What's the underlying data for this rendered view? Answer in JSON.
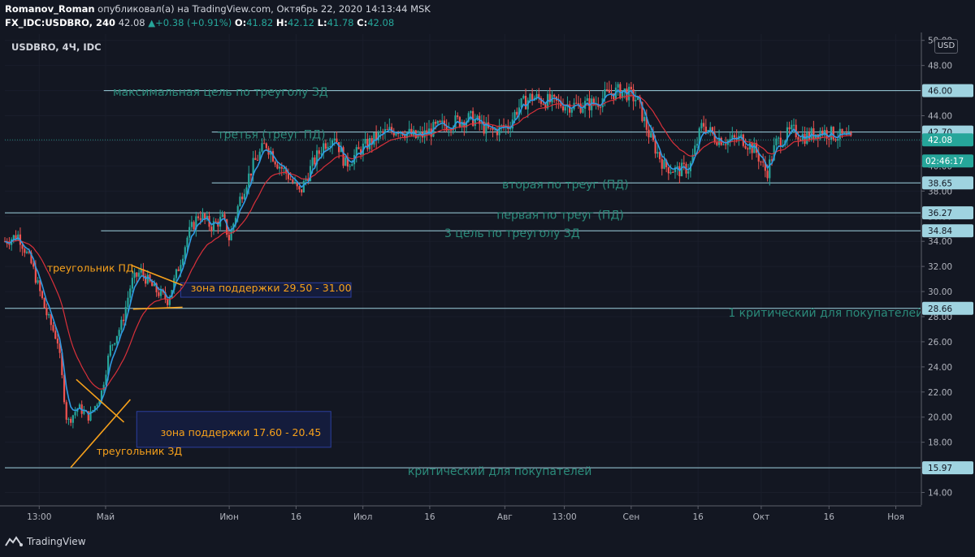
{
  "header": {
    "author": "Romanov_Roman",
    "published_text": " опубликовал(а) на TradingView.com, Октябрь 22, 2020 14:13:44 MSK",
    "ticker": "FX_IDC:USDBRO, 240",
    "last": "42.08",
    "change": "+0.38 (+0.91%)",
    "o_label": "O:",
    "o": "41.82",
    "h_label": "H:",
    "h": "42.12",
    "l_label": "L:",
    "l": "41.78",
    "c_label": "C:",
    "c": "42.08"
  },
  "symbol_label": "USDBRO, 4Ч, IDC",
  "currency_button": "USD",
  "brand": "TradingView",
  "colors": {
    "background": "#131722",
    "level_line": "#9fd3e0",
    "ema_fast": "#2f9ae3",
    "ema_slow": "#d9303a",
    "candle_up": "#26a69a",
    "candle_down": "#ef5350",
    "annotation_teal": "#2b8a7a",
    "annotation_orange": "#f7a11b",
    "zone_border": "#2c3f9f",
    "zone_fill": "#141c3c",
    "price_tag_bg": "#9fd3e0",
    "current_price_bg": "#26a69a"
  },
  "chart_data": {
    "type": "candlestick",
    "instrument": "USDBRO",
    "timeframe": "4Ч",
    "ylim": [
      13,
      50.5
    ],
    "y_ticks": [
      14,
      16,
      18,
      20,
      22,
      24,
      26,
      28,
      30,
      32,
      34,
      36,
      38,
      40,
      42,
      44,
      46,
      48,
      50
    ],
    "y_tick_labels": [
      "14.00",
      "16.00",
      "18.00",
      "20.00",
      "22.00",
      "24.00",
      "26.00",
      "28.00",
      "30.00",
      "32.00",
      "34.00",
      "36.00",
      "38.00",
      "40.00",
      "42.00",
      "44.00",
      "46.00",
      "48.00",
      "50.00"
    ],
    "x_ticks": [
      {
        "label": "13:00",
        "pos": 0.0375
      },
      {
        "label": "Май",
        "pos": 0.11
      },
      {
        "label": "Июн",
        "pos": 0.245
      },
      {
        "label": "16",
        "pos": 0.318
      },
      {
        "label": "Июл",
        "pos": 0.391
      },
      {
        "label": "16",
        "pos": 0.464
      },
      {
        "label": "Авг",
        "pos": 0.546
      },
      {
        "label": "13:00",
        "pos": 0.611
      },
      {
        "label": "Сен",
        "pos": 0.684
      },
      {
        "label": "16",
        "pos": 0.757
      },
      {
        "label": "Окт",
        "pos": 0.826
      },
      {
        "label": "16",
        "pos": 0.9
      },
      {
        "label": "Ноя",
        "pos": 0.973
      }
    ],
    "price_path": [
      [
        0.0,
        34.0
      ],
      [
        0.015,
        34.5
      ],
      [
        0.03,
        32.0
      ],
      [
        0.045,
        28.3
      ],
      [
        0.058,
        26.0
      ],
      [
        0.068,
        19.5
      ],
      [
        0.08,
        20.8
      ],
      [
        0.092,
        20.0
      ],
      [
        0.105,
        21.8
      ],
      [
        0.115,
        25.5
      ],
      [
        0.128,
        27.5
      ],
      [
        0.138,
        30.7
      ],
      [
        0.148,
        31.6
      ],
      [
        0.163,
        30.2
      ],
      [
        0.178,
        29.3
      ],
      [
        0.19,
        32.0
      ],
      [
        0.2,
        34.5
      ],
      [
        0.212,
        36.2
      ],
      [
        0.225,
        35.2
      ],
      [
        0.238,
        35.8
      ],
      [
        0.245,
        34.2
      ],
      [
        0.258,
        37.7
      ],
      [
        0.272,
        40.2
      ],
      [
        0.285,
        41.8
      ],
      [
        0.298,
        40.2
      ],
      [
        0.31,
        39.2
      ],
      [
        0.322,
        37.8
      ],
      [
        0.335,
        40.0
      ],
      [
        0.348,
        41.7
      ],
      [
        0.36,
        42.5
      ],
      [
        0.372,
        40.1
      ],
      [
        0.39,
        41.4
      ],
      [
        0.41,
        42.5
      ],
      [
        0.43,
        43.0
      ],
      [
        0.45,
        42.2
      ],
      [
        0.47,
        43.0
      ],
      [
        0.49,
        43.5
      ],
      [
        0.51,
        43.8
      ],
      [
        0.53,
        42.7
      ],
      [
        0.55,
        43.2
      ],
      [
        0.56,
        44.6
      ],
      [
        0.575,
        45.5
      ],
      [
        0.6,
        45.0
      ],
      [
        0.625,
        44.8
      ],
      [
        0.645,
        45.0
      ],
      [
        0.66,
        45.8
      ],
      [
        0.675,
        46.0
      ],
      [
        0.69,
        45.3
      ],
      [
        0.705,
        42.2
      ],
      [
        0.72,
        40.0
      ],
      [
        0.735,
        39.6
      ],
      [
        0.748,
        39.9
      ],
      [
        0.762,
        43.4
      ],
      [
        0.775,
        42.3
      ],
      [
        0.79,
        42.0
      ],
      [
        0.805,
        42.2
      ],
      [
        0.82,
        41.2
      ],
      [
        0.832,
        39.4
      ],
      [
        0.842,
        41.8
      ],
      [
        0.86,
        42.8
      ],
      [
        0.875,
        42.3
      ],
      [
        0.89,
        42.8
      ],
      [
        0.905,
        42.5
      ],
      [
        0.915,
        42.3
      ],
      [
        0.925,
        42.0
      ]
    ],
    "current_price": {
      "value": 42.08,
      "label": "42.08",
      "timer": "02:46:17"
    },
    "levels": [
      {
        "value": 46.0,
        "label": "46.00",
        "start": 0.108
      },
      {
        "value": 42.7,
        "label": "42.70",
        "start": 0.226
      },
      {
        "value": 38.65,
        "label": "38.65",
        "start": 0.226
      },
      {
        "value": 36.27,
        "label": "36.27",
        "start": 0.0
      },
      {
        "value": 34.84,
        "label": "34.84",
        "start": 0.105
      },
      {
        "value": 28.66,
        "label": "28.66",
        "start": 0.0
      },
      {
        "value": 15.97,
        "label": "15.97",
        "start": 0.0
      }
    ],
    "annotations": [
      {
        "text": "максимальная цель по треуголу ЗД",
        "x": 0.118,
        "y": 45.6,
        "color": "teal"
      },
      {
        "text": "третья (треуг ПД)",
        "x": 0.232,
        "y": 42.2,
        "color": "teal"
      },
      {
        "text": "вторая по  треуг (ПД)",
        "x": 0.543,
        "y": 38.2,
        "color": "teal"
      },
      {
        "text": "первая по треуг (ПД)",
        "x": 0.537,
        "y": 35.8,
        "color": "teal"
      },
      {
        "text": "3 цель по треуголу ЗД",
        "x": 0.48,
        "y": 34.35,
        "color": "teal"
      },
      {
        "text": "1 критический для покупателей",
        "x": 0.79,
        "y": 28.0,
        "color": "teal"
      },
      {
        "text": "критический для покупателей",
        "x": 0.44,
        "y": 15.4,
        "color": "teal"
      },
      {
        "text": "треугольник ПД",
        "x": 0.046,
        "y": 31.6,
        "color": "orange"
      },
      {
        "text": "треугольник ЗД",
        "x": 0.1,
        "y": 17.0,
        "color": "orange"
      },
      {
        "text": "зона поддержки 29.50 - 31.00",
        "x": 0.203,
        "y": 30.0,
        "color": "orange"
      },
      {
        "text": "зона поддержки 17.60 - 20.45",
        "x": 0.17,
        "y": 18.5,
        "color": "orange"
      }
    ],
    "zones": [
      {
        "x0": 0.192,
        "x1": 0.378,
        "y_top": 30.7,
        "y_bottom": 29.55,
        "label_index": 9
      },
      {
        "x0": 0.144,
        "x1": 0.356,
        "y_top": 20.45,
        "y_bottom": 17.6,
        "label_index": 10
      }
    ],
    "drawings": [
      {
        "type": "line",
        "points": [
          [
            0.138,
            32.1
          ],
          [
            0.194,
            30.5
          ]
        ]
      },
      {
        "type": "line",
        "points": [
          [
            0.14,
            28.6
          ],
          [
            0.194,
            28.75
          ]
        ]
      },
      {
        "type": "line",
        "points": [
          [
            0.078,
            23.0
          ],
          [
            0.13,
            19.6
          ]
        ]
      },
      {
        "type": "line",
        "points": [
          [
            0.072,
            16.0
          ],
          [
            0.137,
            21.4
          ]
        ]
      }
    ]
  }
}
